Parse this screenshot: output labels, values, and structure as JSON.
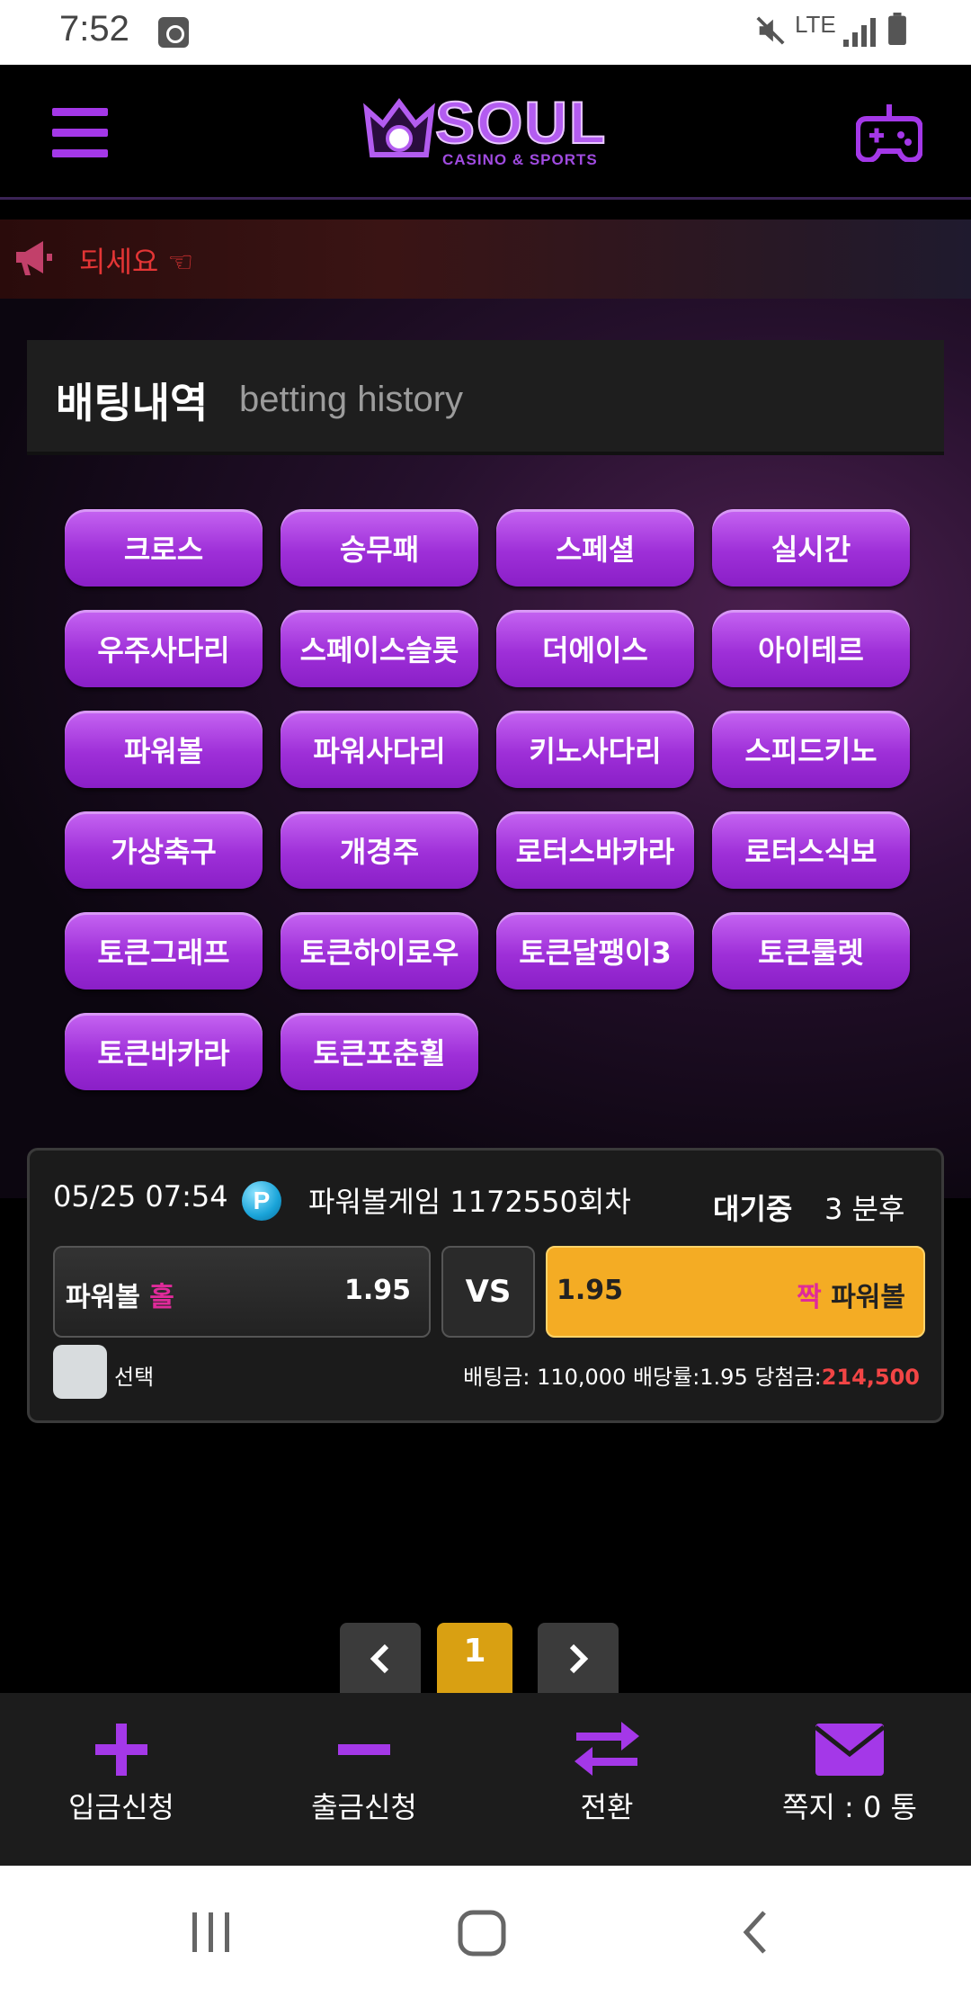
{
  "status_bar": {
    "time": "7:52",
    "network": "LTE"
  },
  "header": {
    "logo_word": "SOUL",
    "logo_tagline": "CASINO & SPORTS"
  },
  "notice": {
    "text": "되세요 ☜"
  },
  "page_title": {
    "korean": "배팅내역",
    "english": "betting history"
  },
  "categories": [
    "크로스",
    "승무패",
    "스페셜",
    "실시간",
    "우주사다리",
    "스페이스슬롯",
    "더에이스",
    "아이테르",
    "파워볼",
    "파워사다리",
    "키노사다리",
    "스피드키노",
    "가상축구",
    "개경주",
    "로터스바카라",
    "로터스식보",
    "토큰그래프",
    "토큰하이로우",
    "토큰달팽이3",
    "토큰룰렛",
    "토큰바카라",
    "토큰포춘휠"
  ],
  "bet": {
    "datetime": "05/25 07:54",
    "game_icon": "P",
    "game_name": "파워볼게임 1172550회차",
    "status": "대기중",
    "status_after": "3 분후",
    "home": {
      "prefix": "파워볼",
      "side": "홀",
      "odds": "1.95"
    },
    "vs_label": "VS",
    "away": {
      "odds": "1.95",
      "side": "짝",
      "suffix": "파워볼"
    },
    "select_label": "선택",
    "summary_prefix": "배팅금: 110,000 배당률:1.95 당첨금:",
    "win_amount": "214,500"
  },
  "pagination": {
    "current": "1"
  },
  "bottom_nav": [
    {
      "label": "입금신청",
      "icon": "plus-icon"
    },
    {
      "label": "출금신청",
      "icon": "minus-icon"
    },
    {
      "label": "전환",
      "icon": "swap-icon"
    },
    {
      "label": "쪽지 : 0 통",
      "icon": "envelope-icon"
    }
  ],
  "colors": {
    "accent": "#a438e8",
    "selected": "#f4ac24",
    "win": "#f24545",
    "page_active": "#d9a012"
  }
}
